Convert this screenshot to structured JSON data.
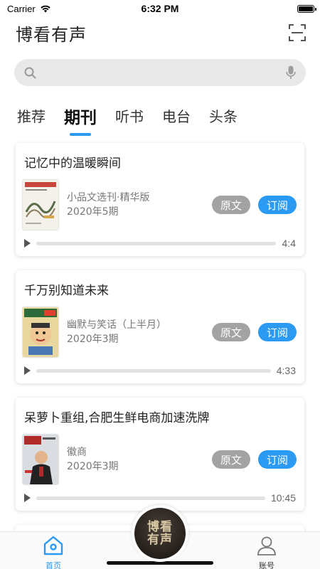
{
  "status_bar": {
    "carrier": "Carrier",
    "time": "6:32 PM"
  },
  "header": {
    "title": "博看有声"
  },
  "search": {
    "placeholder": ""
  },
  "tabs": [
    {
      "label": "推荐",
      "active": false
    },
    {
      "label": "期刊",
      "active": true
    },
    {
      "label": "听书",
      "active": false
    },
    {
      "label": "电台",
      "active": false
    },
    {
      "label": "头条",
      "active": false
    }
  ],
  "feed": [
    {
      "title": "记忆中的温暖瞬间",
      "magazine": "小品文选刊·精华版",
      "issue": "2020年5期",
      "original_label": "原文",
      "subscribe_label": "订阅",
      "duration": "4:4"
    },
    {
      "title": "千万别知道未来",
      "magazine": "幽默与笑话（上半月）",
      "issue": "2020年3期",
      "original_label": "原文",
      "subscribe_label": "订阅",
      "duration": "4:33"
    },
    {
      "title": "呆萝卜重组,合肥生鲜电商加速洗牌",
      "magazine": "徽商",
      "issue": "2020年3期",
      "original_label": "原文",
      "subscribe_label": "订阅",
      "duration": "10:45"
    }
  ],
  "bottom_nav": {
    "home_label": "首页",
    "account_label": "账号",
    "logo_line1": "博看",
    "logo_line2": "有声"
  },
  "colors": {
    "accent": "#2b9af3",
    "button_gray": "#a3a3a3"
  }
}
